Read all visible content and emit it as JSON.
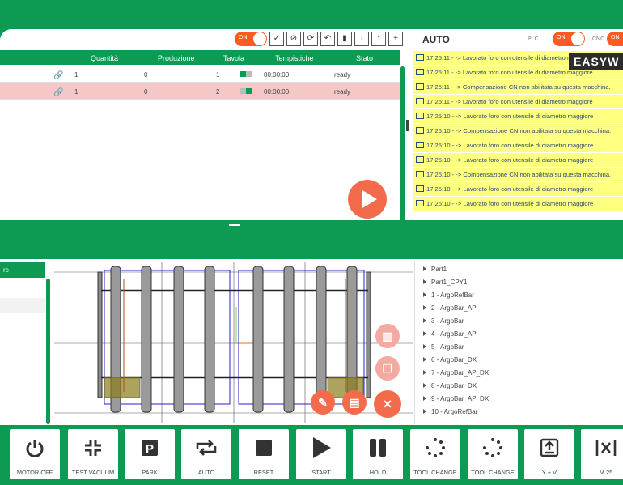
{
  "toolbar": {
    "toggle_label": "ON",
    "buttons": [
      "check-icon",
      "block-icon",
      "refresh-icon",
      "undo-icon",
      "trash-icon",
      "arrow-down-icon",
      "arrow-up-icon",
      "plus-icon"
    ],
    "button_glyphs": [
      "✓",
      "⊘",
      "⟳",
      "↶",
      "▮",
      "↓",
      "↑",
      "+"
    ]
  },
  "table": {
    "columns": [
      "Quantità",
      "Produzione",
      "Tavola",
      "Tempistiche",
      "Stato"
    ],
    "rows": [
      {
        "quantita": "1",
        "produzione": "0",
        "tavola": "1",
        "tempistiche": "00:00:00",
        "stato": "ready"
      },
      {
        "quantita": "1",
        "produzione": "0",
        "tavola": "2",
        "tempistiche": "00:00:00",
        "stato": "ready"
      }
    ]
  },
  "status": {
    "mode": "AUTO",
    "plc_label": "PLC",
    "plc_toggle": "ON",
    "cnc_label": "CNC",
    "cnc_toggle": "ON",
    "brand": "EASYW"
  },
  "log": [
    "17:25:11 - -> Lavorato foro con utensile di diametro maggiore",
    "17:25:11 - -> Lavorato foro con utensile di diametro maggiore",
    "17:25:11 - -> Compensazione CN non abilitata su questa macchina.",
    "17:25:11 - -> Lavorato foro con utensile di diametro maggiore",
    "17:25:10 - -> Lavorato foro con utensile di diametro maggiore",
    "17:25:10 - -> Compensazione CN non abilitata su questa macchina.",
    "17:25:10 - -> Lavorato foro con utensile di diametro maggiore",
    "17:25:10 - -> Lavorato foro con utensile di diametro maggiore",
    "17:25:10 - -> Compensazione CN non abilitata su questa macchina.",
    "17:25:10 - -> Lavorato foro con utensile di diametro maggiore",
    "17:25:10 - -> Lavorato foro con utensile di diametro maggiore"
  ],
  "lower_left": {
    "header": "re"
  },
  "tree": [
    "Part1",
    "Part1_CPY1",
    "1 - ArgoRefBar",
    "2 - ArgoBar_AP",
    "3 - ArgoBar",
    "4 - ArgoBar_AP",
    "5 - ArgoBar",
    "6 - ArgoBar_DX",
    "7 - ArgoBar_AP_DX",
    "8 - ArgoBar_DX",
    "9 - ArgoBar_AP_DX",
    "10 - ArgoRefBar"
  ],
  "colors": {
    "accent": "#0d9a52",
    "alert": "#f36b4a",
    "log_bg": "#ffff80",
    "selected_row": "#f6c7c7"
  },
  "bottom_buttons": [
    {
      "label": "MOTOR OFF",
      "icon": "power-icon"
    },
    {
      "label": "TEST VACUUM",
      "icon": "compress-icon"
    },
    {
      "label": "PARK",
      "icon": "parking-icon"
    },
    {
      "label": "AUTO",
      "icon": "repeat-icon"
    },
    {
      "label": "RESET",
      "icon": "stop-icon"
    },
    {
      "label": "START",
      "icon": "play-icon"
    },
    {
      "label": "HOLD",
      "icon": "pause-icon"
    },
    {
      "label": "TOOL CHANGE",
      "icon": "dots-circle-icon"
    },
    {
      "label": "TOOL CHANGE",
      "icon": "dots-circle-icon"
    },
    {
      "label": "Y + V",
      "icon": "upload-box-icon"
    },
    {
      "label": "M 25",
      "icon": "x-bracket-icon"
    }
  ]
}
